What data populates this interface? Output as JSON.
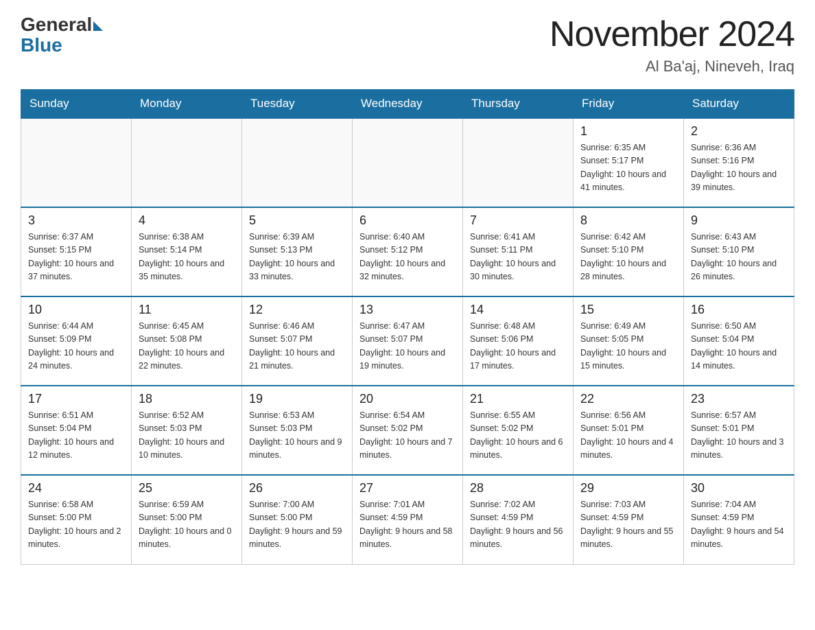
{
  "header": {
    "logo_general": "General",
    "logo_blue": "Blue",
    "title": "November 2024",
    "subtitle": "Al Ba'aj, Nineveh, Iraq"
  },
  "days_of_week": [
    "Sunday",
    "Monday",
    "Tuesday",
    "Wednesday",
    "Thursday",
    "Friday",
    "Saturday"
  ],
  "weeks": [
    [
      {
        "day": "",
        "info": ""
      },
      {
        "day": "",
        "info": ""
      },
      {
        "day": "",
        "info": ""
      },
      {
        "day": "",
        "info": ""
      },
      {
        "day": "",
        "info": ""
      },
      {
        "day": "1",
        "info": "Sunrise: 6:35 AM\nSunset: 5:17 PM\nDaylight: 10 hours and 41 minutes."
      },
      {
        "day": "2",
        "info": "Sunrise: 6:36 AM\nSunset: 5:16 PM\nDaylight: 10 hours and 39 minutes."
      }
    ],
    [
      {
        "day": "3",
        "info": "Sunrise: 6:37 AM\nSunset: 5:15 PM\nDaylight: 10 hours and 37 minutes."
      },
      {
        "day": "4",
        "info": "Sunrise: 6:38 AM\nSunset: 5:14 PM\nDaylight: 10 hours and 35 minutes."
      },
      {
        "day": "5",
        "info": "Sunrise: 6:39 AM\nSunset: 5:13 PM\nDaylight: 10 hours and 33 minutes."
      },
      {
        "day": "6",
        "info": "Sunrise: 6:40 AM\nSunset: 5:12 PM\nDaylight: 10 hours and 32 minutes."
      },
      {
        "day": "7",
        "info": "Sunrise: 6:41 AM\nSunset: 5:11 PM\nDaylight: 10 hours and 30 minutes."
      },
      {
        "day": "8",
        "info": "Sunrise: 6:42 AM\nSunset: 5:10 PM\nDaylight: 10 hours and 28 minutes."
      },
      {
        "day": "9",
        "info": "Sunrise: 6:43 AM\nSunset: 5:10 PM\nDaylight: 10 hours and 26 minutes."
      }
    ],
    [
      {
        "day": "10",
        "info": "Sunrise: 6:44 AM\nSunset: 5:09 PM\nDaylight: 10 hours and 24 minutes."
      },
      {
        "day": "11",
        "info": "Sunrise: 6:45 AM\nSunset: 5:08 PM\nDaylight: 10 hours and 22 minutes."
      },
      {
        "day": "12",
        "info": "Sunrise: 6:46 AM\nSunset: 5:07 PM\nDaylight: 10 hours and 21 minutes."
      },
      {
        "day": "13",
        "info": "Sunrise: 6:47 AM\nSunset: 5:07 PM\nDaylight: 10 hours and 19 minutes."
      },
      {
        "day": "14",
        "info": "Sunrise: 6:48 AM\nSunset: 5:06 PM\nDaylight: 10 hours and 17 minutes."
      },
      {
        "day": "15",
        "info": "Sunrise: 6:49 AM\nSunset: 5:05 PM\nDaylight: 10 hours and 15 minutes."
      },
      {
        "day": "16",
        "info": "Sunrise: 6:50 AM\nSunset: 5:04 PM\nDaylight: 10 hours and 14 minutes."
      }
    ],
    [
      {
        "day": "17",
        "info": "Sunrise: 6:51 AM\nSunset: 5:04 PM\nDaylight: 10 hours and 12 minutes."
      },
      {
        "day": "18",
        "info": "Sunrise: 6:52 AM\nSunset: 5:03 PM\nDaylight: 10 hours and 10 minutes."
      },
      {
        "day": "19",
        "info": "Sunrise: 6:53 AM\nSunset: 5:03 PM\nDaylight: 10 hours and 9 minutes."
      },
      {
        "day": "20",
        "info": "Sunrise: 6:54 AM\nSunset: 5:02 PM\nDaylight: 10 hours and 7 minutes."
      },
      {
        "day": "21",
        "info": "Sunrise: 6:55 AM\nSunset: 5:02 PM\nDaylight: 10 hours and 6 minutes."
      },
      {
        "day": "22",
        "info": "Sunrise: 6:56 AM\nSunset: 5:01 PM\nDaylight: 10 hours and 4 minutes."
      },
      {
        "day": "23",
        "info": "Sunrise: 6:57 AM\nSunset: 5:01 PM\nDaylight: 10 hours and 3 minutes."
      }
    ],
    [
      {
        "day": "24",
        "info": "Sunrise: 6:58 AM\nSunset: 5:00 PM\nDaylight: 10 hours and 2 minutes."
      },
      {
        "day": "25",
        "info": "Sunrise: 6:59 AM\nSunset: 5:00 PM\nDaylight: 10 hours and 0 minutes."
      },
      {
        "day": "26",
        "info": "Sunrise: 7:00 AM\nSunset: 5:00 PM\nDaylight: 9 hours and 59 minutes."
      },
      {
        "day": "27",
        "info": "Sunrise: 7:01 AM\nSunset: 4:59 PM\nDaylight: 9 hours and 58 minutes."
      },
      {
        "day": "28",
        "info": "Sunrise: 7:02 AM\nSunset: 4:59 PM\nDaylight: 9 hours and 56 minutes."
      },
      {
        "day": "29",
        "info": "Sunrise: 7:03 AM\nSunset: 4:59 PM\nDaylight: 9 hours and 55 minutes."
      },
      {
        "day": "30",
        "info": "Sunrise: 7:04 AM\nSunset: 4:59 PM\nDaylight: 9 hours and 54 minutes."
      }
    ]
  ]
}
